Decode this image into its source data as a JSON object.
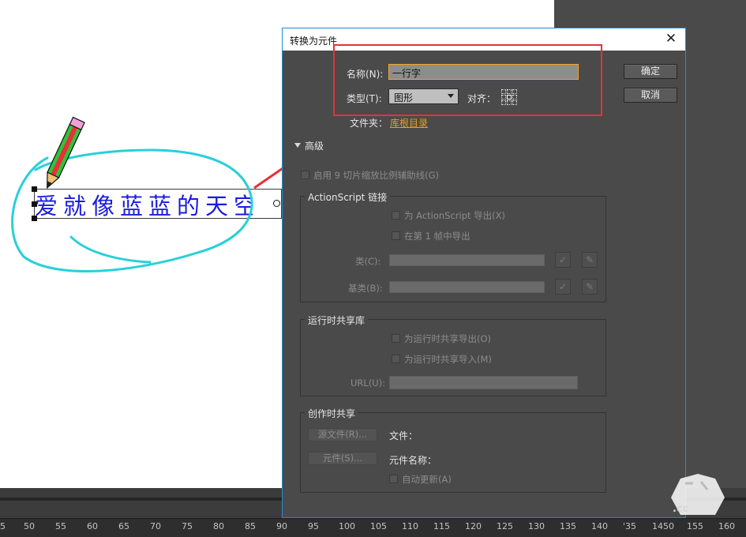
{
  "canvas": {
    "text": "爱就像蓝蓝的天空"
  },
  "timeline": {
    "ruler_labels": [
      "5",
      "50",
      "55",
      "60",
      "65",
      "70",
      "75",
      "80",
      "85",
      "90",
      "95",
      "100",
      "105",
      "110",
      "115",
      "120",
      "125",
      "130",
      "135",
      "140",
      "'35",
      "1450",
      "155",
      "160"
    ]
  },
  "dialog": {
    "title": "转换为元件",
    "close_glyph": "✕",
    "name_label": "名称(N):",
    "name_value": "一行字",
    "type_label": "类型(T):",
    "type_value": "图形",
    "align_label": "对齐：",
    "folder_label": "文件夹：",
    "folder_link": "库根目录",
    "ok_button": "确定",
    "cancel_button": "取消",
    "advanced_label": "高级",
    "scale9_label": "启用 9 切片缩放比例辅助线(G)",
    "actionscript": {
      "title": "ActionScript 链接",
      "export_as": "为 ActionScript 导出(X)",
      "export_frame1": "在第 1 帧中导出",
      "class_label": "类(C):",
      "base_class_label": "基类(B):"
    },
    "runtime_sharing": {
      "title": "运行时共享库",
      "export_runtime": "为运行时共享导出(O)",
      "import_runtime": "为运行时共享导入(M)",
      "url_label": "URL(U):"
    },
    "authortime_sharing": {
      "title": "创作时共享",
      "source_file_button": "源文件(R)...",
      "file_label": "文件：",
      "symbol_button": "元件(S)...",
      "symbol_name_label": "元件名称：",
      "auto_update": "自动更新(A)"
    }
  },
  "watermark": {
    "text": ".cc"
  },
  "colors": {
    "dialog_bg": "#4a4a4a",
    "accent_orange": "#f0a92c",
    "annotation_red": "#e8303a",
    "annotation_cyan": "#28d0d8",
    "canvas_text_blue": "#1a1ae0"
  }
}
